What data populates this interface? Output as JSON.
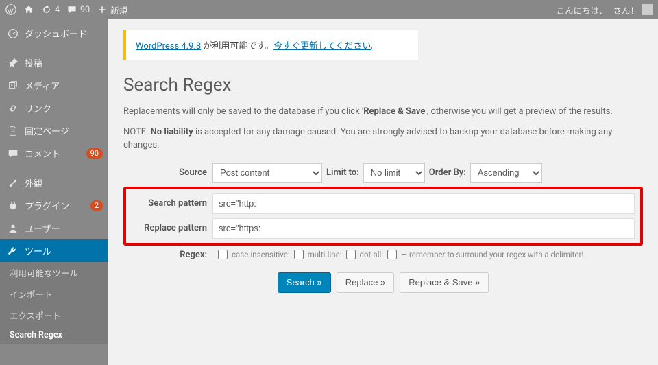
{
  "adminbar": {
    "refresh_count": "4",
    "comment_count": "90",
    "new_label": "新規",
    "greeting": "こんにちは、",
    "user_suffix": "さん！"
  },
  "sidebar": {
    "items": [
      {
        "id": "dashboard",
        "label": "ダッシュボード"
      },
      {
        "id": "posts",
        "label": "投稿"
      },
      {
        "id": "media",
        "label": "メディア"
      },
      {
        "id": "links",
        "label": "リンク"
      },
      {
        "id": "pages",
        "label": "固定ページ"
      },
      {
        "id": "comments",
        "label": "コメント",
        "badge": "90"
      },
      {
        "id": "appearance",
        "label": "外観"
      },
      {
        "id": "plugins",
        "label": "プラグイン",
        "badge": "2"
      },
      {
        "id": "users",
        "label": "ユーザー"
      },
      {
        "id": "tools",
        "label": "ツール"
      }
    ],
    "submenu_tools": [
      {
        "id": "available-tools",
        "label": "利用可能なツール"
      },
      {
        "id": "import",
        "label": "インポート"
      },
      {
        "id": "export",
        "label": "エクスポート"
      },
      {
        "id": "search-regex",
        "label": "Search Regex"
      }
    ]
  },
  "update_nag": {
    "link1": "WordPress 4.9.8",
    "middle": " が利用可能です。",
    "link2": "今すぐ更新してください",
    "tail": "。"
  },
  "page": {
    "title": "Search Regex",
    "intro_before": "Replacements will only be saved to the database if you click '",
    "intro_strong": "Replace & Save",
    "intro_after": "', otherwise you will get a preview of the results.",
    "note2_before": "NOTE: ",
    "note2_strong": "No liability",
    "note2_after": " is accepted for any damage caused. You are strongly advised to backup your database before making any changes."
  },
  "form": {
    "source_label": "Source",
    "source_value": "Post content",
    "limit_label": "Limit to:",
    "limit_value": "No limit",
    "order_label": "Order By:",
    "order_value": "Ascending",
    "search_label": "Search pattern",
    "search_value": "src=\"http:",
    "replace_label": "Replace pattern",
    "replace_value": "src=\"https:",
    "regex_label": "Regex:",
    "opt_ci": "case-insensitive:",
    "opt_ml": "multi-line:",
    "opt_da": "dot-all:",
    "regex_hint": "— remember to surround your regex with a delimiter!"
  },
  "buttons": {
    "search": "Search »",
    "replace": "Replace »",
    "replace_save": "Replace & Save »"
  }
}
